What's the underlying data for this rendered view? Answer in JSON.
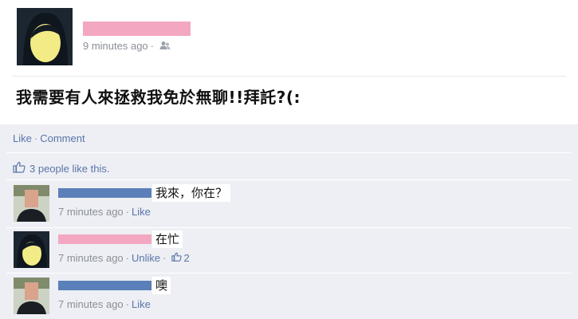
{
  "post": {
    "time": "9 minutes ago",
    "separator": "·",
    "text": "我需要有人來拯救我免於無聊!!拜託?(:"
  },
  "feedback": {
    "like_label": "Like",
    "comment_label": "Comment",
    "separator": "·",
    "likes_text": "3 people like this."
  },
  "comments": [
    {
      "text": "我來，你在？",
      "time": "7 minutes ago",
      "action": "Like",
      "like_count": ""
    },
    {
      "text": "在忙",
      "time": "7 minutes ago",
      "action": "Unlike",
      "like_count": "2"
    },
    {
      "text": "噢",
      "time": "7 minutes ago",
      "action": "Like",
      "like_count": ""
    }
  ],
  "colors": {
    "link": "#5b74a8",
    "meta": "#8a8f98",
    "feedback_bg": "#edeff4",
    "redact_pink": "#f4a7c1",
    "redact_blue": "#5b7fb8"
  },
  "icons": [
    "audience-icon",
    "thumbs-up-icon"
  ]
}
